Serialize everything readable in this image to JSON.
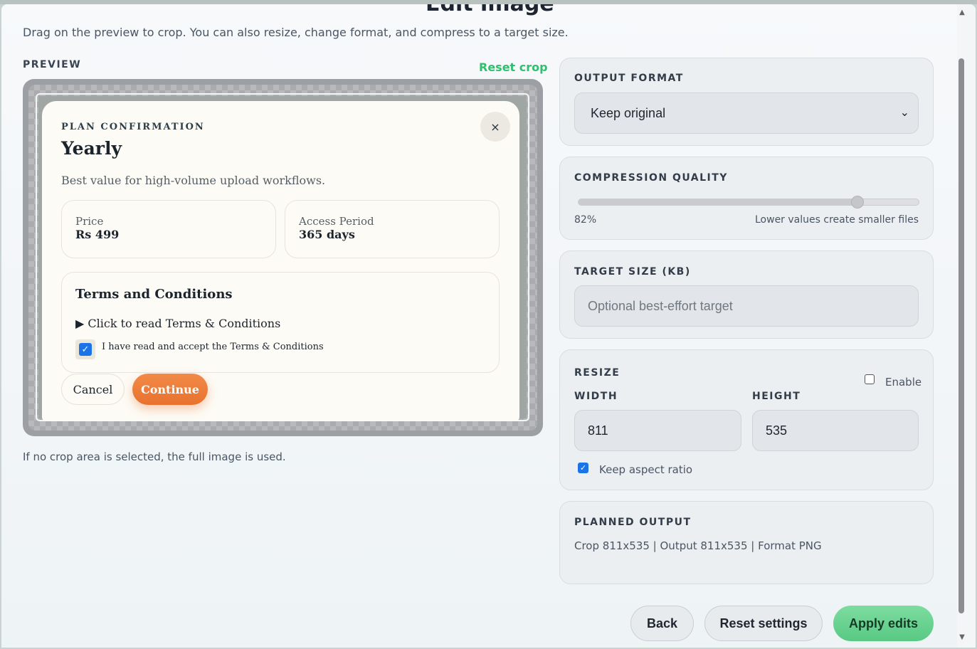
{
  "title": "Edit image",
  "description": "Drag on the preview to crop. You can also resize, change format, and compress to a target size.",
  "preview": {
    "label": "PREVIEW",
    "reset_crop": "Reset crop",
    "hint": "If no crop area is selected, the full image is used.",
    "dialog": {
      "eyebrow": "PLAN CONFIRMATION",
      "plan_name": "Yearly",
      "close": "×",
      "description": "Best value for high-volume upload workflows.",
      "price_label": "Price",
      "price_value": "Rs 499",
      "period_label": "Access Period",
      "period_value": "365 days",
      "terms_title": "Terms and Conditions",
      "terms_toggle": "▶ Click to read Terms & Conditions",
      "terms_accept": "I have read and accept the Terms & Conditions",
      "terms_checked": true,
      "cancel": "Cancel",
      "continue": "Continue"
    }
  },
  "output_format": {
    "label": "OUTPUT FORMAT",
    "value": "Keep original"
  },
  "compression": {
    "label": "COMPRESSION QUALITY",
    "value_text": "82%",
    "value": 0.82,
    "hint": "Lower values create smaller files"
  },
  "target_size": {
    "label": "TARGET SIZE (KB)",
    "placeholder": "Optional best-effort target"
  },
  "resize": {
    "label": "RESIZE",
    "enable_label": "Enable",
    "enabled": false,
    "width_label": "WIDTH",
    "width_value": "811",
    "height_label": "HEIGHT",
    "height_value": "535",
    "keep_aspect_label": "Keep aspect ratio",
    "keep_aspect": true
  },
  "planned_output": {
    "label": "PLANNED OUTPUT",
    "summary": "Crop 811x535 | Output 811x535 | Format PNG"
  },
  "actions": {
    "back": "Back",
    "reset_settings": "Reset settings",
    "apply": "Apply edits"
  },
  "colors": {
    "accent_green": "#2fbf6e",
    "apply_green": "#58c983",
    "continue_orange": "#e8722e",
    "checkbox_blue": "#1a73e8"
  }
}
